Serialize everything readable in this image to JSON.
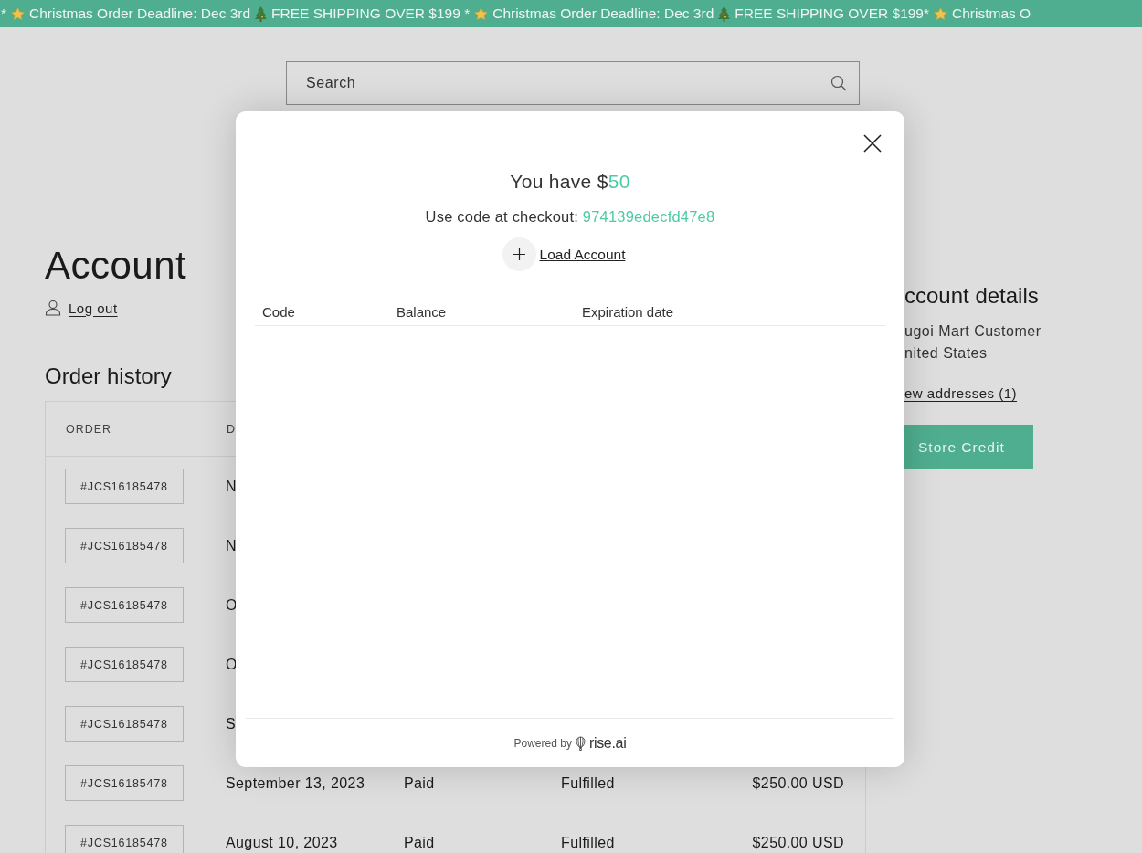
{
  "announcement_bar": {
    "items": [
      {
        "kind": "text",
        "text": "*"
      },
      {
        "kind": "star"
      },
      {
        "kind": "text",
        "text": "Christmas Order Deadline: Dec 3rd"
      },
      {
        "kind": "tree"
      },
      {
        "kind": "text",
        "text": "FREE SHIPPING OVER $199 *"
      },
      {
        "kind": "star"
      },
      {
        "kind": "text",
        "text": "Christmas Order Deadline: Dec 3rd"
      },
      {
        "kind": "tree"
      },
      {
        "kind": "text",
        "text": "FREE SHIPPING OVER $199*"
      },
      {
        "kind": "star"
      },
      {
        "kind": "text",
        "text": "Christmas O"
      }
    ]
  },
  "header": {
    "search": {
      "placeholder": "Search"
    }
  },
  "account": {
    "title": "Account",
    "logout": "Log out",
    "order_history": {
      "title": "Order history",
      "columns": [
        "ORDER",
        "D"
      ],
      "rows": [
        {
          "order": "#JCS16185478",
          "date": "N"
        },
        {
          "order": "#JCS16185478",
          "date": "N"
        },
        {
          "order": "#JCS16185478",
          "date": "O"
        },
        {
          "order": "#JCS16185478",
          "date": "O"
        },
        {
          "order": "#JCS16185478",
          "date": "S"
        },
        {
          "order": "#JCS16185478",
          "date": "September 13, 2023",
          "payment": "Paid",
          "fulfillment": "Fulfilled",
          "total": "$250.00 USD"
        },
        {
          "order": "#JCS16185478",
          "date": "August 10, 2023",
          "payment": "Paid",
          "fulfillment": "Fulfilled",
          "total": "$250.00 USD"
        }
      ]
    }
  },
  "account_details": {
    "title": "ccount details",
    "lines": [
      "ugoi Mart Customer",
      "nited States"
    ],
    "addresses_link": "ew addresses (1)",
    "store_credit_button": "Store Credit"
  },
  "modal": {
    "balance_prefix": "You have $",
    "balance_amount": "50",
    "code_label": "Use code at checkout: ",
    "code": "974139edecfd47e8",
    "load_account": "Load Account",
    "columns": [
      "Code",
      "Balance",
      "Expiration date"
    ],
    "footer": {
      "powered_by": "Powered by",
      "brand": "rise.ai"
    }
  }
}
